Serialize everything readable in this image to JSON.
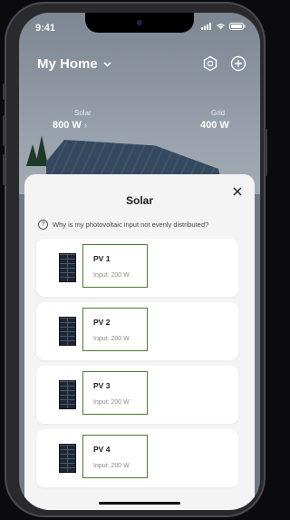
{
  "status": {
    "time": "9:41"
  },
  "header": {
    "title": "My Home",
    "settings_icon": "gear-icon",
    "add_icon": "plus-circle-icon"
  },
  "stats": {
    "solar": {
      "label": "Solar",
      "value": "800 W"
    },
    "grid": {
      "label": "Grid",
      "value": "400 W"
    }
  },
  "sheet": {
    "title": "Solar",
    "help_text": "Why is my photovoltaic input not evenly distributed?",
    "panels": [
      {
        "name": "PV 1",
        "input": "Input: 200 W"
      },
      {
        "name": "PV 2",
        "input": "Input: 200 W"
      },
      {
        "name": "PV 3",
        "input": "Input: 200 W"
      },
      {
        "name": "PV 4",
        "input": "Input: 200 W"
      }
    ]
  },
  "colors": {
    "accent_border": "#4e7a34",
    "sheet_bg": "#f4f4f5"
  }
}
